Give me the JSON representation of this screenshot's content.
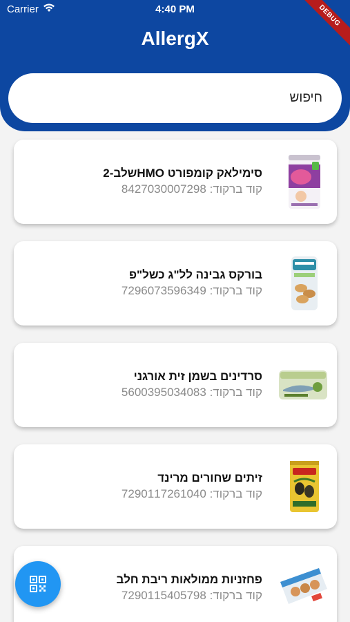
{
  "status_bar": {
    "carrier": "Carrier",
    "time": "4:40 PM"
  },
  "debug_banner": "DEBUG",
  "header": {
    "title": "AllergX"
  },
  "search": {
    "placeholder": "חיפוש"
  },
  "barcode_label": "קוד ברקוד:",
  "products": [
    {
      "name": "סימילאק קומפורט HMOשלב-2",
      "barcode": "8427030007298",
      "image": "similac-can"
    },
    {
      "name": "בורקס גבינה לל\"ג כשל\"פ",
      "barcode": "7296073596349",
      "image": "borekas-pack"
    },
    {
      "name": "סרדינים בשמן זית אורגני",
      "barcode": "5600395034083",
      "image": "sardine-tin"
    },
    {
      "name": "זיתים שחורים מרינד",
      "barcode": "7290117261040",
      "image": "olive-can"
    },
    {
      "name": "פחזניות ממולאות ריבת חלב",
      "barcode": "7290115405798",
      "image": "cream-puff-box"
    }
  ],
  "fab": {
    "icon": "qr-code-icon"
  },
  "colors": {
    "primary": "#0d47a1",
    "fab": "#2196f3",
    "background": "#f3f3f3"
  }
}
